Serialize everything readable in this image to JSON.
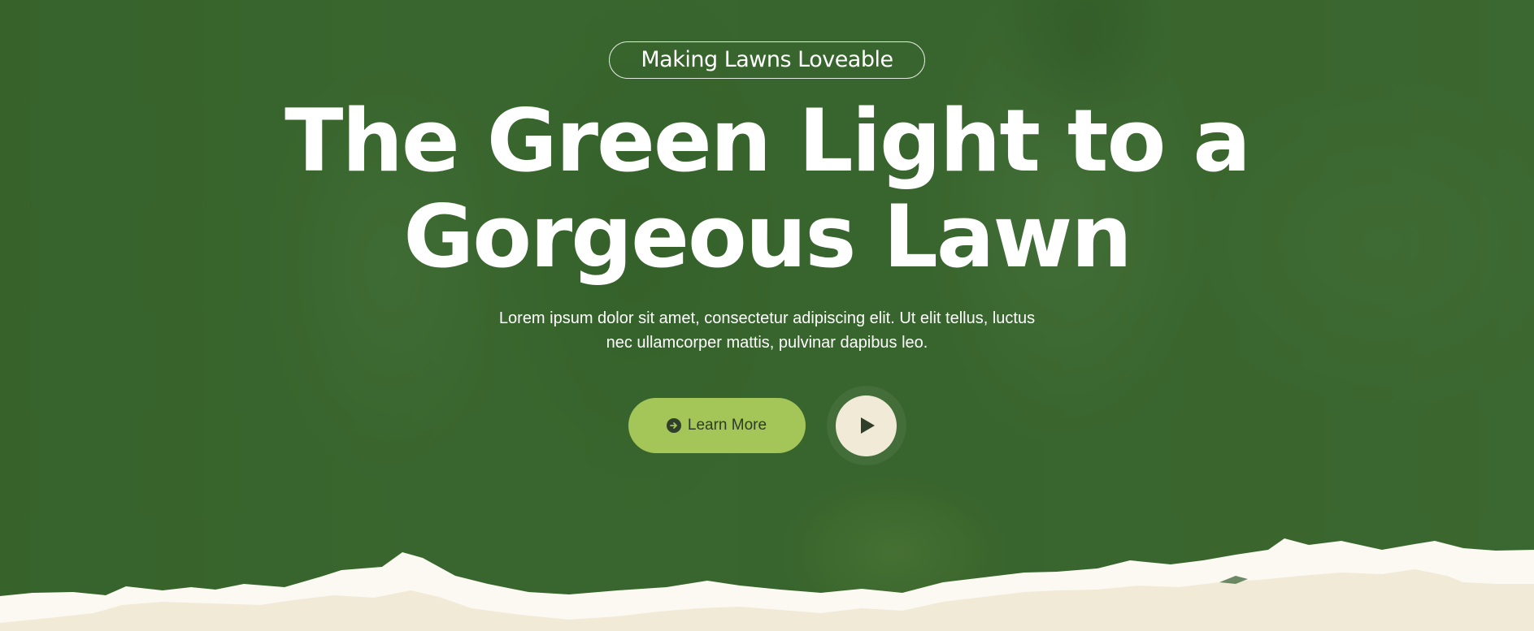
{
  "hero": {
    "tagline": "Making Lawns Loveable",
    "headline_line1": "The Green Light to a",
    "headline_line2": "Gorgeous Lawn",
    "description_line1": "Lorem ipsum dolor sit amet, consectetur adipiscing elit. Ut elit tellus, luctus",
    "description_line2": "nec ullamcorper mattis, pulvinar dapibus leo.",
    "learn_more_label": "Learn More",
    "learn_more_icon": "arrow-circle-right-icon",
    "play_icon": "play-icon"
  },
  "colors": {
    "overlay_green": "#3f6b35",
    "button_green": "#a4c659",
    "cream": "#f1ead7",
    "paper_white": "#fbf9f2"
  }
}
